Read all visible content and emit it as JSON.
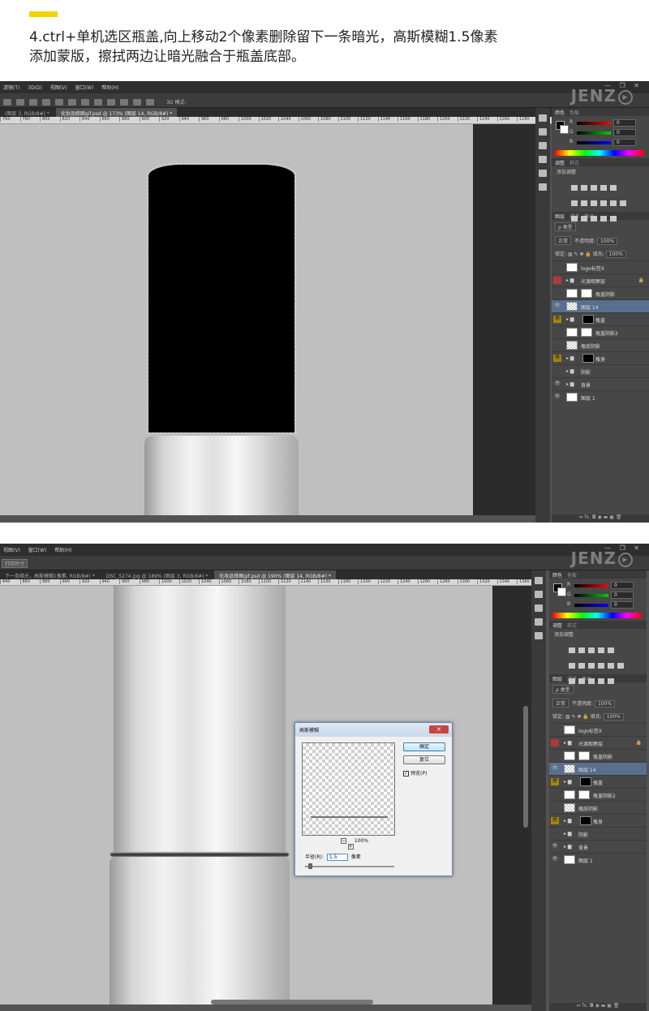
{
  "instruction": {
    "line1": "4.ctrl+单机选区瓶盖,向上移动2个像素删除留下一条暗光，高斯模糊1.5像素",
    "line2": "添加蒙版，擦拭两边让暗光融合于瓶盖底部。"
  },
  "colors": {
    "accent": "#f5d300",
    "canvas_bg": "#bfbfbf",
    "selected_layer": "#5a6f8e"
  },
  "watermark": "JENZ",
  "shot1": {
    "menu": [
      "滤镜(T)",
      "3D(D)",
      "视图(V)",
      "窗口(W)",
      "帮助(H)"
    ],
    "options_label": "3D 模式:",
    "tabs": [
      "(图层 3, RGB/8#) *",
      "化妆品修图gif.psd @ 173% (图层 14, RGB/8#) *"
    ],
    "ruler": [
      "760",
      "780",
      "800",
      "820",
      "840",
      "860",
      "880",
      "900",
      "920",
      "940",
      "960",
      "980",
      "1000",
      "1020",
      "1040",
      "1060",
      "1080",
      "1100",
      "1120",
      "1140",
      "1160",
      "1180",
      "1200",
      "1220",
      "1240",
      "1260",
      "1280"
    ],
    "panel": {
      "color_tabs": [
        "颜色",
        "色板"
      ],
      "rgb": [
        {
          "ch": "R",
          "val": "0"
        },
        {
          "ch": "G",
          "val": "0"
        },
        {
          "ch": "B",
          "val": "0"
        }
      ],
      "adj_tabs": [
        "调整",
        "样式"
      ],
      "adj_label": "添加调整",
      "layer_tabs": [
        "图层",
        "通道",
        "路径"
      ],
      "filter_kind": "ρ 类型",
      "blend": "正常",
      "opacity_label": "不透明度:",
      "opacity": "100%",
      "lock_label": "锁定:",
      "fill_label": "填充:",
      "fill": "100%",
      "layers": [
        {
          "name": "logo标签X",
          "eye": "",
          "kind": "thumb"
        },
        {
          "name": "光源观察层",
          "eye": "red",
          "kind": "folder",
          "lock": "🔒"
        },
        {
          "name": "瓶盖阴影",
          "eye": "",
          "kind": "mask"
        },
        {
          "name": "图层 14",
          "eye": "eye",
          "kind": "chk",
          "sel": true
        },
        {
          "name": "瓶盖",
          "eye": "yel",
          "kind": "folder-mask"
        },
        {
          "name": "瓶盖阴影2",
          "eye": "",
          "kind": "mask"
        },
        {
          "name": "瓶底阴影",
          "eye": "",
          "kind": "chk"
        },
        {
          "name": "瓶身",
          "eye": "yel",
          "kind": "folder-mask"
        },
        {
          "name": "阴影",
          "eye": "",
          "kind": "folder"
        },
        {
          "name": "背景",
          "eye": "eye",
          "kind": "folder"
        },
        {
          "name": "图层 1",
          "eye": "eye",
          "kind": "thumb"
        }
      ],
      "footer": "⇔ fx. ◘ ◉ ▬ ▣ 🗑"
    }
  },
  "shot2": {
    "menu": [
      "视图(V)",
      "窗口(W)",
      "帮助(H)"
    ],
    "options_label": "打印尺寸",
    "tabs": [
      "下一条暗光，高斯模糊1像素, RGB/8#) *",
      "DSC_5274.jpg @ 189% (图层 3, RGB/8#) *",
      "化妆品修图gif.psd @ 190% (图层 14, RGB/8#) *"
    ],
    "ruler": [
      "840",
      "860",
      "880",
      "900",
      "920",
      "940",
      "960",
      "980",
      "1000",
      "1020",
      "1040",
      "1060",
      "1080",
      "1100",
      "1120",
      "1140",
      "1160",
      "1180",
      "1200",
      "1220",
      "1240",
      "1260",
      "1280",
      "1300",
      "1320",
      "1340",
      "1360",
      "1380",
      "1400",
      "1420"
    ],
    "dialog": {
      "title": "高斯模糊",
      "close": "✕",
      "ok": "确定",
      "reset": "复位",
      "preview_label": "预览(P)",
      "preview_checked": "✓",
      "zoom": "100%",
      "zoom_out": "−",
      "zoom_in": "+",
      "radius_label": "半径(R):",
      "radius": "1.5",
      "radius_unit": "像素"
    }
  }
}
